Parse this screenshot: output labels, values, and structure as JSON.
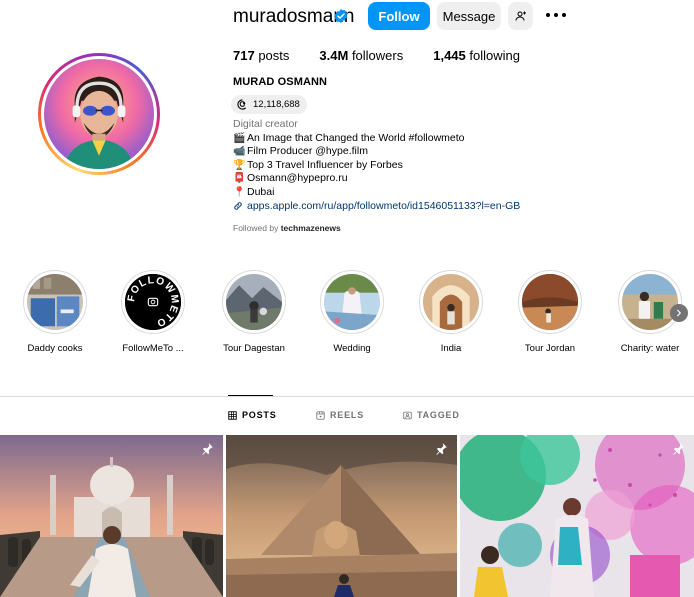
{
  "profile": {
    "username": "muradosmann",
    "full_name": "MURAD OSMANN",
    "verified": true,
    "threads_count": "12,118,688",
    "stats": {
      "posts_value": "717",
      "posts_label": "posts",
      "followers_value": "3.4M",
      "followers_label": "followers",
      "following_value": "1,445",
      "following_label": "following"
    },
    "bio": {
      "category": "Digital creator",
      "lines": [
        {
          "icon": "film-icon",
          "text": " An Image that Changed the World #followmeto"
        },
        {
          "icon": "camera-icon",
          "text": "Film Producer @hype.film"
        },
        {
          "icon": "trophy-icon",
          "text": "Top 3 Travel Influencer by Forbes"
        },
        {
          "icon": "mailbox-icon",
          "text": " Osmann@hypepro.ru"
        },
        {
          "icon": "pin-icon",
          "text": " Dubai"
        }
      ],
      "link": "apps.apple.com/ru/app/followmeto/id1546051133?l=en-GB"
    },
    "followed_by_prefix": "Followed by ",
    "followed_by_user": "techmazenews"
  },
  "actions": {
    "follow_label": "Follow",
    "message_label": "Message"
  },
  "highlights": [
    {
      "label": "Daddy cooks"
    },
    {
      "label": "FollowMeTo ..."
    },
    {
      "label": "Tour Dagestan"
    },
    {
      "label": "Wedding"
    },
    {
      "label": "India"
    },
    {
      "label": "Tour Jordan"
    },
    {
      "label": "Charity: water"
    }
  ],
  "highlight_badge_text": "FOLLOWMETO",
  "tabs": [
    {
      "label": "POSTS",
      "icon": "grid-icon",
      "active": true
    },
    {
      "label": "REELS",
      "icon": "reels-icon",
      "active": false
    },
    {
      "label": "TAGGED",
      "icon": "tagged-icon",
      "active": false
    }
  ],
  "posts": [
    {
      "scene": "taj-mahal",
      "pinned": true
    },
    {
      "scene": "pyramid-sphinx",
      "pinned": true
    },
    {
      "scene": "holi-festival",
      "pinned": true
    }
  ],
  "colors": {
    "follow_blue": "#0095f6",
    "link_blue": "#00376b",
    "secondary_gray": "#737373",
    "button_gray": "#efefef",
    "border_gray": "#dbdbdb"
  }
}
